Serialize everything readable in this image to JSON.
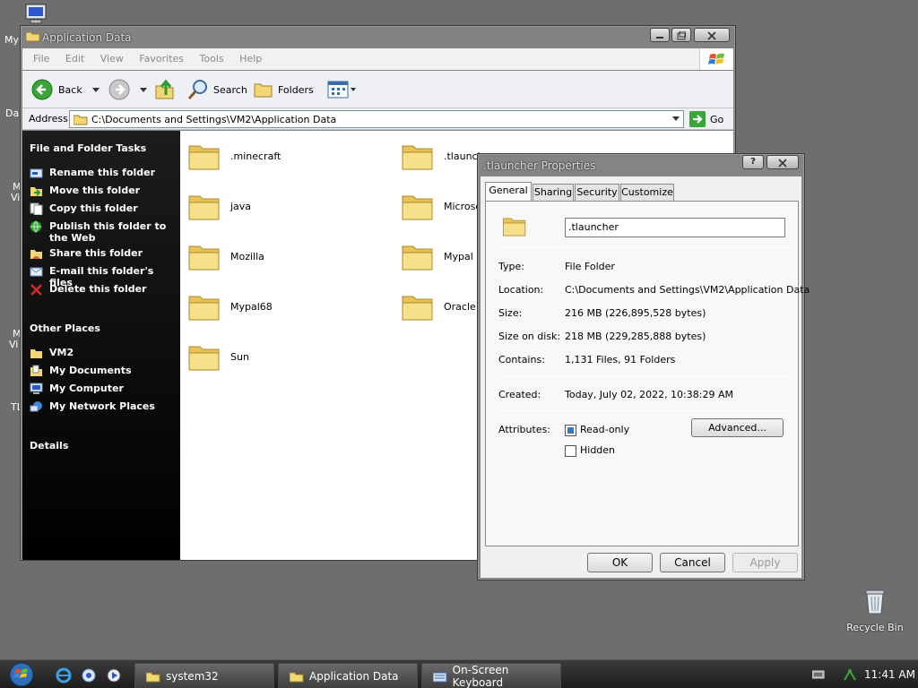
{
  "desktop": {
    "left_labels": [
      "My",
      "Da",
      "M",
      "Vi",
      "M",
      "Vi",
      "TL"
    ],
    "recycle_bin": "Recycle Bin"
  },
  "explorer": {
    "title": "Application Data",
    "menu": [
      "File",
      "Edit",
      "View",
      "Favorites",
      "Tools",
      "Help"
    ],
    "toolbar": {
      "back": "Back",
      "search": "Search",
      "folders": "Folders"
    },
    "address_label": "Address",
    "address_value": "C:\\Documents and Settings\\VM2\\Application Data",
    "go": "Go",
    "tasks": {
      "header": "File and Folder Tasks",
      "items": [
        "Rename this folder",
        "Move this folder",
        "Copy this folder",
        "Publish this folder to the Web",
        "Share this folder",
        "E-mail this folder's files",
        "Delete this folder"
      ],
      "other_places_header": "Other Places",
      "other_places": [
        "VM2",
        "My Documents",
        "My Computer",
        "My Network Places"
      ],
      "details_header": "Details"
    },
    "folders": [
      ".minecraft",
      ".tlauncher",
      "java",
      "Microsoft",
      "Mozilla",
      "Mypal",
      "Mypal68",
      "Oracle",
      "Sun"
    ]
  },
  "dialog": {
    "title": ".tlauncher Properties",
    "tabs": [
      "General",
      "Sharing",
      "Security",
      "Customize"
    ],
    "name_value": ".tlauncher",
    "fields": {
      "type_label": "Type:",
      "type_value": "File Folder",
      "location_label": "Location:",
      "location_value": "C:\\Documents and Settings\\VM2\\Application Data",
      "size_label": "Size:",
      "size_value": "216 MB (226,895,528 bytes)",
      "size_on_disk_label": "Size on disk:",
      "size_on_disk_value": "218 MB (229,285,888 bytes)",
      "contains_label": "Contains:",
      "contains_value": "1,131 Files, 91 Folders",
      "created_label": "Created:",
      "created_value": "Today, July 02, 2022, 10:38:29 AM",
      "attributes_label": "Attributes:"
    },
    "readonly_label": "Read-only",
    "hidden_label": "Hidden",
    "advanced": "Advanced...",
    "ok": "OK",
    "cancel": "Cancel",
    "apply": "Apply"
  },
  "taskbar": {
    "buttons": [
      "system32",
      "Application Data",
      "On-Screen Keyboard"
    ],
    "clock": "11:41 AM"
  },
  "colors": {
    "desktop": "#6e6e6e",
    "taskbar": "#2a2a2a",
    "folder": "#f2d774",
    "tasks_panel": "#000000"
  }
}
